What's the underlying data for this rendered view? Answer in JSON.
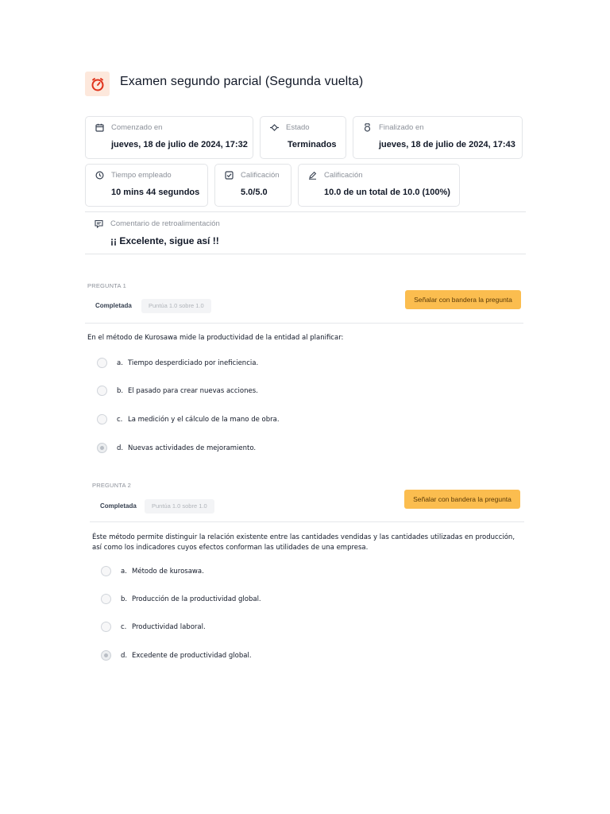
{
  "header": {
    "title": "Examen segundo parcial (Segunda vuelta)",
    "icon": "stopwatch-icon",
    "icon_color": "#e0321b",
    "icon_bg": "#fde8dc"
  },
  "summary": {
    "started": {
      "label": "Comenzado en",
      "value": "jueves, 18 de julio de 2024, 17:32",
      "icon": "calendar-icon"
    },
    "state": {
      "label": "Estado",
      "value": "Terminados",
      "icon": "diamond-icon"
    },
    "finished": {
      "label": "Finalizado en",
      "value": "jueves, 18 de julio de 2024, 17:43",
      "icon": "medal-icon"
    },
    "time_taken": {
      "label": "Tiempo empleado",
      "value": "10 mins 44 segundos",
      "icon": "clock-icon"
    },
    "marks": {
      "label": "Calificación",
      "value": "5.0/5.0",
      "icon": "checkbox-icon"
    },
    "grade": {
      "label": "Calificación",
      "value": "10.0 de un total de 10.0 (100%)",
      "icon": "pencil-icon"
    },
    "feedback": {
      "label": "Comentario de retroalimentación",
      "value": "¡¡ Excelente, sigue así !!",
      "icon": "comment-icon"
    }
  },
  "questions": [
    {
      "number_label": "PREGUNTA 1",
      "state": "Completada",
      "score": "Puntúa 1.0 sobre 1.0",
      "flag_label": "Señalar con bandera la pregunta",
      "text": "En el método de Kurosawa mide la productividad de la entidad al planificar:",
      "options": [
        {
          "letter": "a.",
          "text": "Tiempo desperdiciado por ineficiencia.",
          "selected": false
        },
        {
          "letter": "b.",
          "text": "El pasado para crear nuevas acciones.",
          "selected": false
        },
        {
          "letter": "c.",
          "text": "La medición y el cálculo de la mano de obra.",
          "selected": false
        },
        {
          "letter": "d.",
          "text": "Nuevas actividades de mejoramiento.",
          "selected": true
        }
      ]
    },
    {
      "number_label": "PREGUNTA 2",
      "state": "Completada",
      "score": "Puntúa 1.0 sobre 1.0",
      "flag_label": "Señalar con bandera la pregunta",
      "text": "Éste método permite distinguir la relación existente entre las cantidades vendidas y las cantidades utilizadas en producción, así como los indicadores cuyos efectos conforman las utilidades de una empresa.",
      "options": [
        {
          "letter": "a.",
          "text": "Método de kurosawa.",
          "selected": false
        },
        {
          "letter": "b.",
          "text": "Producción de la productividad global.",
          "selected": false
        },
        {
          "letter": "c.",
          "text": "Productividad laboral.",
          "selected": false
        },
        {
          "letter": "d.",
          "text": "Excedente de productividad global.",
          "selected": true
        }
      ]
    }
  ]
}
